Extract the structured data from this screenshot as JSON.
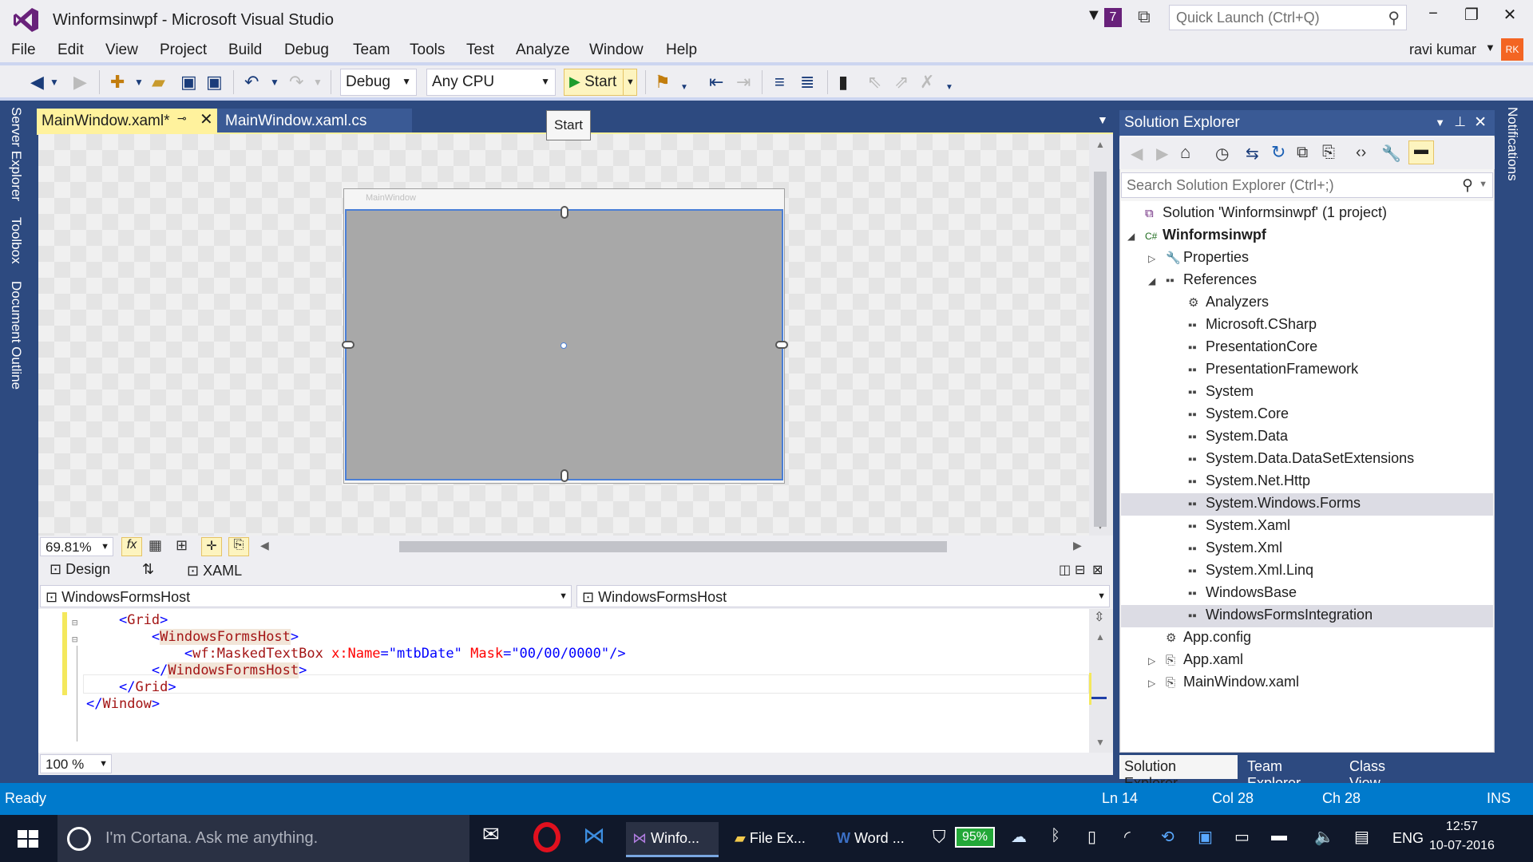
{
  "window": {
    "title": "Winformsinwpf - Microsoft Visual Studio",
    "notif_count": "7",
    "quick_launch_placeholder": "Quick Launch (Ctrl+Q)"
  },
  "menu": [
    "File",
    "Edit",
    "View",
    "Project",
    "Build",
    "Debug",
    "Team",
    "Tools",
    "Test",
    "Analyze",
    "Window",
    "Help"
  ],
  "user": {
    "name": "ravi kumar",
    "initials": "RK"
  },
  "toolbar": {
    "config": "Debug",
    "platform": "Any CPU",
    "start_label": "Start",
    "tooltip": "Start"
  },
  "left_tabs": [
    "Server Explorer",
    "Toolbox",
    "Document Outline"
  ],
  "right_tabs": [
    "Notifications"
  ],
  "doc_tabs": [
    {
      "label": "MainWindow.xaml*",
      "active": true
    },
    {
      "label": "MainWindow.xaml.cs",
      "active": false
    }
  ],
  "designer": {
    "window_title": "MainWindow",
    "zoom": "69.81%"
  },
  "split": {
    "design": "Design",
    "xaml": "XAML"
  },
  "nav": {
    "left": "WindowsFormsHost",
    "right": "WindowsFormsHost"
  },
  "code": [
    {
      "indent": 2,
      "parts": [
        [
          "br",
          "<"
        ],
        [
          "tag",
          "Grid"
        ],
        [
          "br",
          ">"
        ]
      ]
    },
    {
      "indent": 4,
      "parts": [
        [
          "br",
          "<"
        ],
        [
          "tag",
          "WindowsFormsHost"
        ],
        [
          "br",
          ">"
        ]
      ]
    },
    {
      "indent": 6,
      "parts": [
        [
          "br",
          "<"
        ],
        [
          "tag",
          "wf:MaskedTextBox"
        ],
        [
          "attr",
          " x:Name"
        ],
        [
          "br",
          "="
        ],
        [
          "val",
          "\"mtbDate\""
        ],
        [
          "attr",
          " Mask"
        ],
        [
          "br",
          "="
        ],
        [
          "val",
          "\"00/00/0000\""
        ],
        [
          "br",
          "/>"
        ]
      ]
    },
    {
      "indent": 4,
      "parts": [
        [
          "br",
          "</"
        ],
        [
          "tag",
          "WindowsFormsHost"
        ],
        [
          "br",
          ">"
        ]
      ]
    },
    {
      "indent": 2,
      "parts": [
        [
          "br",
          "</"
        ],
        [
          "tag",
          "Grid"
        ],
        [
          "br",
          ">"
        ]
      ]
    },
    {
      "indent": 0,
      "parts": [
        [
          "br",
          "</"
        ],
        [
          "tag",
          "Window"
        ],
        [
          "br",
          ">"
        ]
      ]
    }
  ],
  "editor_zoom": "100 %",
  "solution_explorer": {
    "title": "Solution Explorer",
    "search_placeholder": "Search Solution Explorer (Ctrl+;)",
    "items": [
      {
        "label": "Solution 'Winformsinwpf' (1 project)",
        "level": 0,
        "icon": "solution-icon",
        "expander": ""
      },
      {
        "label": "Winformsinwpf",
        "level": 0,
        "icon": "csharp-project-icon",
        "expander": "◢",
        "bold": true
      },
      {
        "label": "Properties",
        "level": 1,
        "icon": "wrench-icon",
        "expander": "▷"
      },
      {
        "label": "References",
        "level": 1,
        "icon": "references-icon",
        "expander": "◢"
      },
      {
        "label": "Analyzers",
        "level": 2,
        "icon": "analyzer-icon",
        "expander": ""
      },
      {
        "label": "Microsoft.CSharp",
        "level": 2,
        "icon": "reference-icon",
        "expander": ""
      },
      {
        "label": "PresentationCore",
        "level": 2,
        "icon": "reference-icon",
        "expander": ""
      },
      {
        "label": "PresentationFramework",
        "level": 2,
        "icon": "reference-icon",
        "expander": ""
      },
      {
        "label": "System",
        "level": 2,
        "icon": "reference-icon",
        "expander": ""
      },
      {
        "label": "System.Core",
        "level": 2,
        "icon": "reference-icon",
        "expander": ""
      },
      {
        "label": "System.Data",
        "level": 2,
        "icon": "reference-icon",
        "expander": ""
      },
      {
        "label": "System.Data.DataSetExtensions",
        "level": 2,
        "icon": "reference-icon",
        "expander": ""
      },
      {
        "label": "System.Net.Http",
        "level": 2,
        "icon": "reference-icon",
        "expander": ""
      },
      {
        "label": "System.Windows.Forms",
        "level": 2,
        "icon": "reference-icon",
        "expander": "",
        "selected": true
      },
      {
        "label": "System.Xaml",
        "level": 2,
        "icon": "reference-icon",
        "expander": ""
      },
      {
        "label": "System.Xml",
        "level": 2,
        "icon": "reference-icon",
        "expander": ""
      },
      {
        "label": "System.Xml.Linq",
        "level": 2,
        "icon": "reference-icon",
        "expander": ""
      },
      {
        "label": "WindowsBase",
        "level": 2,
        "icon": "reference-icon",
        "expander": ""
      },
      {
        "label": "WindowsFormsIntegration",
        "level": 2,
        "icon": "reference-icon",
        "expander": "",
        "selected": true
      },
      {
        "label": "App.config",
        "level": 1,
        "icon": "config-icon",
        "expander": ""
      },
      {
        "label": "App.xaml",
        "level": 1,
        "icon": "xaml-file-icon",
        "expander": "▷"
      },
      {
        "label": "MainWindow.xaml",
        "level": 1,
        "icon": "xaml-file-icon",
        "expander": "▷"
      }
    ],
    "tabs": [
      "Solution Explorer",
      "Team Explorer",
      "Class View"
    ]
  },
  "status": {
    "state": "Ready",
    "ln": "Ln 14",
    "col": "Col 28",
    "ch": "Ch 28",
    "mode": "INS"
  },
  "taskbar": {
    "cortana": "I'm Cortana. Ask me anything.",
    "apps": [
      "Winfo...",
      "File Ex...",
      "Word ..."
    ],
    "battery": "95%",
    "lang": "ENG",
    "time": "12:57",
    "date": "10-07-2016"
  }
}
